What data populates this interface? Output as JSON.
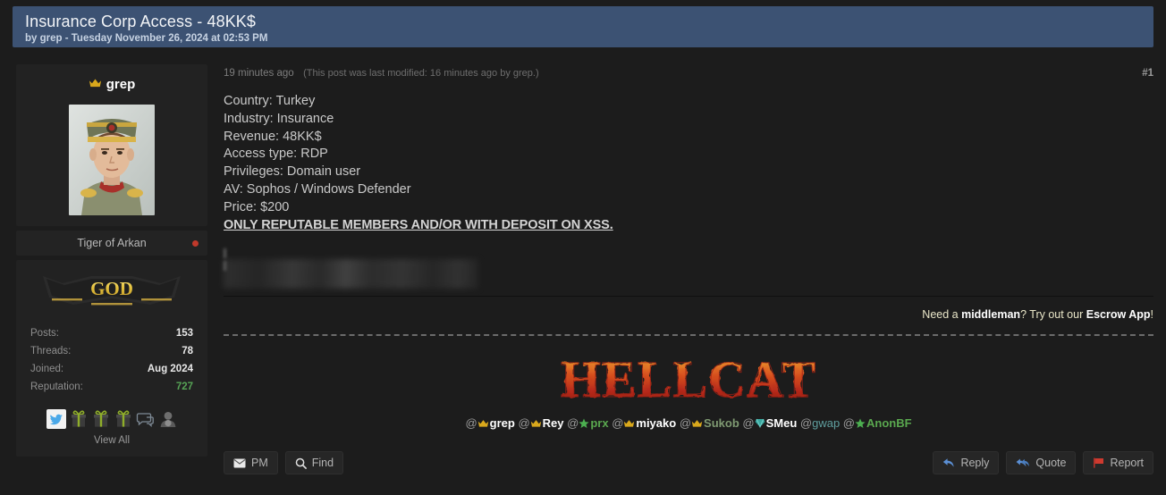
{
  "thread": {
    "title": "Insurance Corp Access - 48KK$",
    "byline": "by grep - Tuesday November 26, 2024 at 02:53 PM"
  },
  "post": {
    "date": "19 minutes ago",
    "edited": "(This post was last modified: 16 minutes ago by grep.)",
    "number": "#1",
    "lines": [
      "Country: Turkey",
      "Industry: Insurance",
      "Revenue: 48KK$",
      "Access type: RDP",
      "Privileges: Domain user",
      "AV: Sophos / Windows Defender",
      "Price: $200"
    ],
    "emphasis": "ONLY REPUTABLE MEMBERS AND/OR WITH DEPOSIT ON XSS.",
    "redacted_note": "blurred-quote-block"
  },
  "sidebar": {
    "username": "grep",
    "rank_icon": "crown-icon",
    "avatar_alt": "avatar-photo",
    "usertitle": "Tiger of Arkan",
    "status": "offline",
    "status_color": "#c0392b",
    "rank_banner_text": "GOD",
    "stats": [
      {
        "key": "Posts:",
        "value": "153",
        "color": "#e8e8e8"
      },
      {
        "key": "Threads:",
        "value": "78",
        "color": "#e8e8e8"
      },
      {
        "key": "Joined:",
        "value": "Aug 2024",
        "color": "#e8e8e8"
      },
      {
        "key": "Reputation:",
        "value": "727",
        "color": "#56a355"
      }
    ],
    "awards": [
      "twitter-icon",
      "gift-icon",
      "gift-icon",
      "gift-icon",
      "speech-bubble-icon",
      "person-icon"
    ],
    "view_all": "View All"
  },
  "escrow": {
    "prefix": "Need a ",
    "bold1": "middleman",
    "middle": "? Try out our ",
    "bold2": "Escrow App",
    "suffix": "!"
  },
  "signature": {
    "logo_text": "HELLCAT",
    "mentions": [
      {
        "at": "@",
        "icon": "crown-icon",
        "name": "grep",
        "color": "#ffffff"
      },
      {
        "at": "@",
        "icon": "crown-icon",
        "name": "Rey",
        "color": "#ffffff"
      },
      {
        "at": "@",
        "icon": "star-icon",
        "name": "prx",
        "color": "#5aa84f"
      },
      {
        "at": "@",
        "icon": "crown-icon",
        "name": "miyako",
        "color": "#ffffff"
      },
      {
        "at": "@",
        "icon": "crown-icon",
        "name": "Sukob",
        "color": "#7f9a72"
      },
      {
        "at": "@",
        "icon": "gem-icon",
        "name": "SMeu",
        "color": "#ffffff"
      },
      {
        "at": "@",
        "icon": "none",
        "name": "gwap",
        "color": "#5f9e9e"
      },
      {
        "at": "@",
        "icon": "star-icon",
        "name": "AnonBF",
        "color": "#5aa84f"
      }
    ]
  },
  "footer": {
    "left_buttons": [
      {
        "label": "PM",
        "icon": "envelope-icon"
      },
      {
        "label": "Find",
        "icon": "search-icon"
      }
    ],
    "right_buttons": [
      {
        "label": "Reply",
        "icon": "reply-arrow-icon"
      },
      {
        "label": "Quote",
        "icon": "quote-arrows-icon"
      },
      {
        "label": "Report",
        "icon": "flag-icon"
      }
    ]
  }
}
